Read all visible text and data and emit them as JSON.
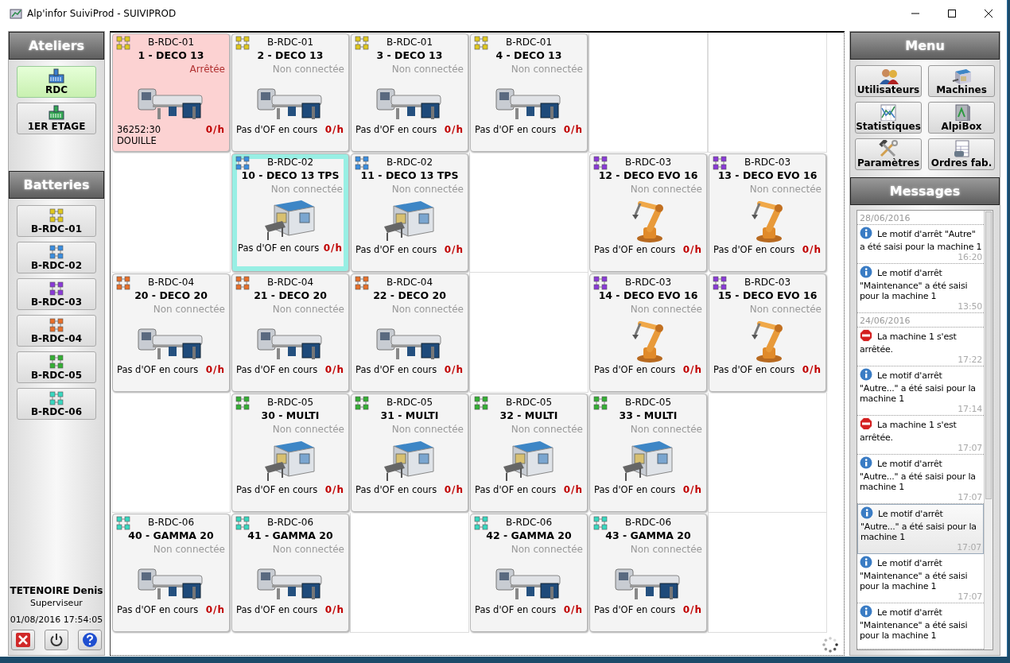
{
  "window": {
    "title": "Alp'infor SuiviProd - SUIVIPROD"
  },
  "left_panel": {
    "ateliers_title": "Ateliers",
    "ateliers": [
      {
        "label": "RDC",
        "selected": true,
        "color": "#3a7fd0"
      },
      {
        "label": "1ER ETAGE",
        "selected": false,
        "color": "#34a853"
      }
    ],
    "batteries_title": "Batteries",
    "batteries": [
      {
        "label": "B-RDC-01",
        "color": "#e0c820"
      },
      {
        "label": "B-RDC-02",
        "color": "#3a8ee0"
      },
      {
        "label": "B-RDC-03",
        "color": "#8a3ad8"
      },
      {
        "label": "B-RDC-04",
        "color": "#e8702a"
      },
      {
        "label": "B-RDC-05",
        "color": "#34b034"
      },
      {
        "label": "B-RDC-06",
        "color": "#38d8c0"
      }
    ],
    "user": {
      "name": "TETENOIRE Denis",
      "role": "Superviseur",
      "datetime": "01/08/2016 17:54:05"
    }
  },
  "grid": [
    [
      {
        "kind": "lathe",
        "battery": "B-RDC-01",
        "color": "#e0c820",
        "name": "1 - DECO 13",
        "stopped": true,
        "status": "Arrêtée",
        "footer": [
          "36252:30",
          "DOUILLE"
        ],
        "rate": "0/h",
        "selected": false
      },
      {
        "kind": "lathe",
        "battery": "B-RDC-01",
        "color": "#e0c820",
        "name": "2 - DECO 13",
        "stopped": false,
        "status": "Non connectée",
        "footer": [
          "Pas d'OF en cours"
        ],
        "rate": "0/h",
        "selected": false
      },
      {
        "kind": "lathe",
        "battery": "B-RDC-01",
        "color": "#e0c820",
        "name": "3 - DECO 13",
        "stopped": false,
        "status": "Non connectée",
        "footer": [
          "Pas d'OF en cours"
        ],
        "rate": "0/h",
        "selected": false
      },
      {
        "kind": "lathe",
        "battery": "B-RDC-01",
        "color": "#e0c820",
        "name": "4 - DECO 13",
        "stopped": false,
        "status": "Non connectée",
        "footer": [
          "Pas d'OF en cours"
        ],
        "rate": "0/h",
        "selected": false
      },
      {
        "kind": "empty"
      },
      {
        "kind": "empty"
      }
    ],
    [
      {
        "kind": "empty"
      },
      {
        "kind": "conveyor",
        "battery": "B-RDC-02",
        "color": "#3a8ee0",
        "name": "10 - DECO 13 TPS",
        "stopped": false,
        "status": "Non connectée",
        "footer": [
          "Pas d'OF en cours"
        ],
        "rate": "0/h",
        "selected": true
      },
      {
        "kind": "conveyor",
        "battery": "B-RDC-02",
        "color": "#3a8ee0",
        "name": "11 - DECO 13 TPS",
        "stopped": false,
        "status": "Non connectée",
        "footer": [
          "Pas d'OF en cours"
        ],
        "rate": "0/h",
        "selected": false
      },
      {
        "kind": "empty"
      },
      {
        "kind": "robot",
        "battery": "B-RDC-03",
        "color": "#8a3ad8",
        "name": "12 - DECO EVO 16",
        "stopped": false,
        "status": "Non connectée",
        "footer": [
          "Pas d'OF en cours"
        ],
        "rate": "0/h",
        "selected": false
      },
      {
        "kind": "robot",
        "battery": "B-RDC-03",
        "color": "#8a3ad8",
        "name": "13 - DECO EVO 16",
        "stopped": false,
        "status": "Non connectée",
        "footer": [
          "Pas d'OF en cours"
        ],
        "rate": "0/h",
        "selected": false
      }
    ],
    [
      {
        "kind": "lathe",
        "battery": "B-RDC-04",
        "color": "#e8702a",
        "name": "20 - DECO 20",
        "stopped": false,
        "status": "Non connectée",
        "footer": [
          "Pas d'OF en cours"
        ],
        "rate": "0/h",
        "selected": false
      },
      {
        "kind": "lathe",
        "battery": "B-RDC-04",
        "color": "#e8702a",
        "name": "21 - DECO 20",
        "stopped": false,
        "status": "Non connectée",
        "footer": [
          "Pas d'OF en cours"
        ],
        "rate": "0/h",
        "selected": false
      },
      {
        "kind": "lathe",
        "battery": "B-RDC-04",
        "color": "#e8702a",
        "name": "22 - DECO 20",
        "stopped": false,
        "status": "Non connectée",
        "footer": [
          "Pas d'OF en cours"
        ],
        "rate": "0/h",
        "selected": false
      },
      {
        "kind": "empty"
      },
      {
        "kind": "robot",
        "battery": "B-RDC-03",
        "color": "#8a3ad8",
        "name": "14 - DECO EVO 16",
        "stopped": false,
        "status": "Non connectée",
        "footer": [
          "Pas d'OF en cours"
        ],
        "rate": "0/h",
        "selected": false
      },
      {
        "kind": "robot",
        "battery": "B-RDC-03",
        "color": "#8a3ad8",
        "name": "15 - DECO EVO 16",
        "stopped": false,
        "status": "Non connectée",
        "footer": [
          "Pas d'OF en cours"
        ],
        "rate": "0/h",
        "selected": false
      }
    ],
    [
      {
        "kind": "empty"
      },
      {
        "kind": "conveyor",
        "battery": "B-RDC-05",
        "color": "#34b034",
        "name": "30 - MULTI",
        "stopped": false,
        "status": "Non connectée",
        "footer": [
          "Pas d'OF en cours"
        ],
        "rate": "0/h",
        "selected": false
      },
      {
        "kind": "conveyor",
        "battery": "B-RDC-05",
        "color": "#34b034",
        "name": "31 - MULTI",
        "stopped": false,
        "status": "Non connectée",
        "footer": [
          "Pas d'OF en cours"
        ],
        "rate": "0/h",
        "selected": false
      },
      {
        "kind": "conveyor",
        "battery": "B-RDC-05",
        "color": "#34b034",
        "name": "32 - MULTI",
        "stopped": false,
        "status": "Non connectée",
        "footer": [
          "Pas d'OF en cours"
        ],
        "rate": "0/h",
        "selected": false
      },
      {
        "kind": "conveyor",
        "battery": "B-RDC-05",
        "color": "#34b034",
        "name": "33 - MULTI",
        "stopped": false,
        "status": "Non connectée",
        "footer": [
          "Pas d'OF en cours"
        ],
        "rate": "0/h",
        "selected": false
      },
      {
        "kind": "empty"
      }
    ],
    [
      {
        "kind": "lathe",
        "battery": "B-RDC-06",
        "color": "#38d8c0",
        "name": "40 - GAMMA 20",
        "stopped": false,
        "status": "Non connectée",
        "footer": [
          "Pas d'OF en cours"
        ],
        "rate": "0/h",
        "selected": false
      },
      {
        "kind": "lathe",
        "battery": "B-RDC-06",
        "color": "#38d8c0",
        "name": "41 - GAMMA 20",
        "stopped": false,
        "status": "Non connectée",
        "footer": [
          "Pas d'OF en cours"
        ],
        "rate": "0/h",
        "selected": false
      },
      {
        "kind": "empty"
      },
      {
        "kind": "lathe",
        "battery": "B-RDC-06",
        "color": "#38d8c0",
        "name": "42 - GAMMA 20",
        "stopped": false,
        "status": "Non connectée",
        "footer": [
          "Pas d'OF en cours"
        ],
        "rate": "0/h",
        "selected": false
      },
      {
        "kind": "lathe",
        "battery": "B-RDC-06",
        "color": "#38d8c0",
        "name": "43 - GAMMA 20",
        "stopped": false,
        "status": "Non connectée",
        "footer": [
          "Pas d'OF en cours"
        ],
        "rate": "0/h",
        "selected": false
      },
      {
        "kind": "empty"
      }
    ]
  ],
  "right_panel": {
    "menu_title": "Menu",
    "menu": [
      "Utilisateurs",
      "Machines",
      "Statistiques",
      "AlpiBox",
      "Paramètres",
      "Ordres fab."
    ],
    "messages_title": "Messages",
    "message_groups": [
      {
        "date": "28/06/2016",
        "messages": [
          {
            "kind": "info",
            "text": "Le motif d'arrêt \"Autre\" a été saisi pour la machine 1",
            "time": "16:20",
            "selected": false
          },
          {
            "kind": "info",
            "text": "Le motif d'arrêt \"Maintenance\" a été saisi pour la machine 1",
            "time": "13:50",
            "selected": false
          }
        ]
      },
      {
        "date": "24/06/2016",
        "messages": [
          {
            "kind": "stop",
            "text": "La machine 1 s'est arrêtée.",
            "time": "17:22",
            "selected": false
          },
          {
            "kind": "info",
            "text": "Le motif d'arrêt \"Autre...\" a été saisi pour la machine 1",
            "time": "17:14",
            "selected": false
          },
          {
            "kind": "stop",
            "text": "La machine 1 s'est arrêtée.",
            "time": "17:07",
            "selected": false
          },
          {
            "kind": "info",
            "text": "Le motif d'arrêt \"Autre...\" a été saisi pour la machine 1",
            "time": "17:07",
            "selected": false
          },
          {
            "kind": "info",
            "text": "Le motif d'arrêt \"Autre...\" a été saisi pour la machine 1",
            "time": "17:07",
            "selected": true
          },
          {
            "kind": "info",
            "text": "Le motif d'arrêt \"Maintenance\" a été saisi pour la machine 1",
            "time": "17:07",
            "selected": false
          },
          {
            "kind": "info",
            "text": "Le motif d'arrêt \"Maintenance\" a été saisi pour la machine 1",
            "selected": false
          }
        ]
      }
    ]
  }
}
